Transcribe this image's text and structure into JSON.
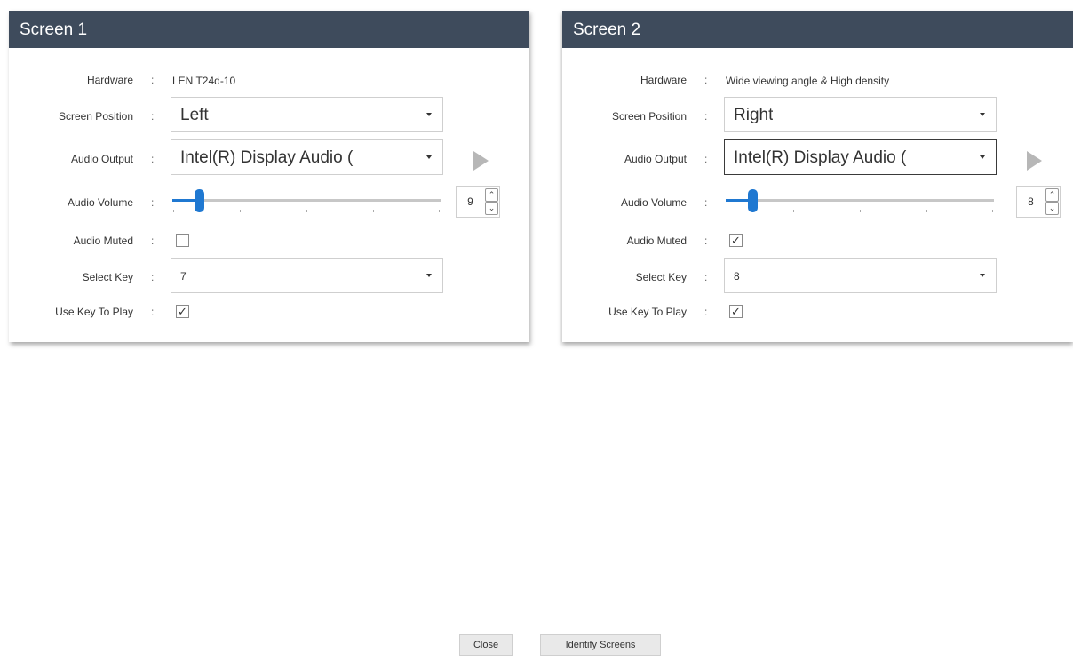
{
  "labels": {
    "hardware": "Hardware",
    "screen_position": "Screen Position",
    "audio_output": "Audio Output",
    "audio_volume": "Audio Volume",
    "audio_muted": "Audio Muted",
    "select_key": "Select Key",
    "use_key_to_play": "Use Key To Play",
    "colon": ":"
  },
  "screens": [
    {
      "title": "Screen 1",
      "hardware": "LEN T24d-10",
      "screen_position": "Left",
      "audio_output": "Intel(R) Display Audio (",
      "audio_volume": "9",
      "audio_volume_level": 0.1,
      "audio_muted": false,
      "select_key": "7",
      "use_key_to_play": true
    },
    {
      "title": "Screen 2",
      "hardware": "Wide viewing angle & High density",
      "screen_position": "Right",
      "audio_output": "Intel(R) Display Audio (",
      "audio_volume": "8",
      "audio_volume_level": 0.1,
      "audio_muted": true,
      "select_key": "8",
      "use_key_to_play": true
    }
  ],
  "buttons": {
    "close": "Close",
    "identify": "Identify Screens"
  },
  "icons": {
    "play": "play-icon",
    "spin_up": "chevron-up-icon",
    "spin_down": "chevron-down-icon",
    "dropdown": "dropdown-arrow-icon",
    "checkmark": "checkmark-icon"
  },
  "colors": {
    "header": "#3e4b5c",
    "slider_accent": "#1f78d1"
  }
}
